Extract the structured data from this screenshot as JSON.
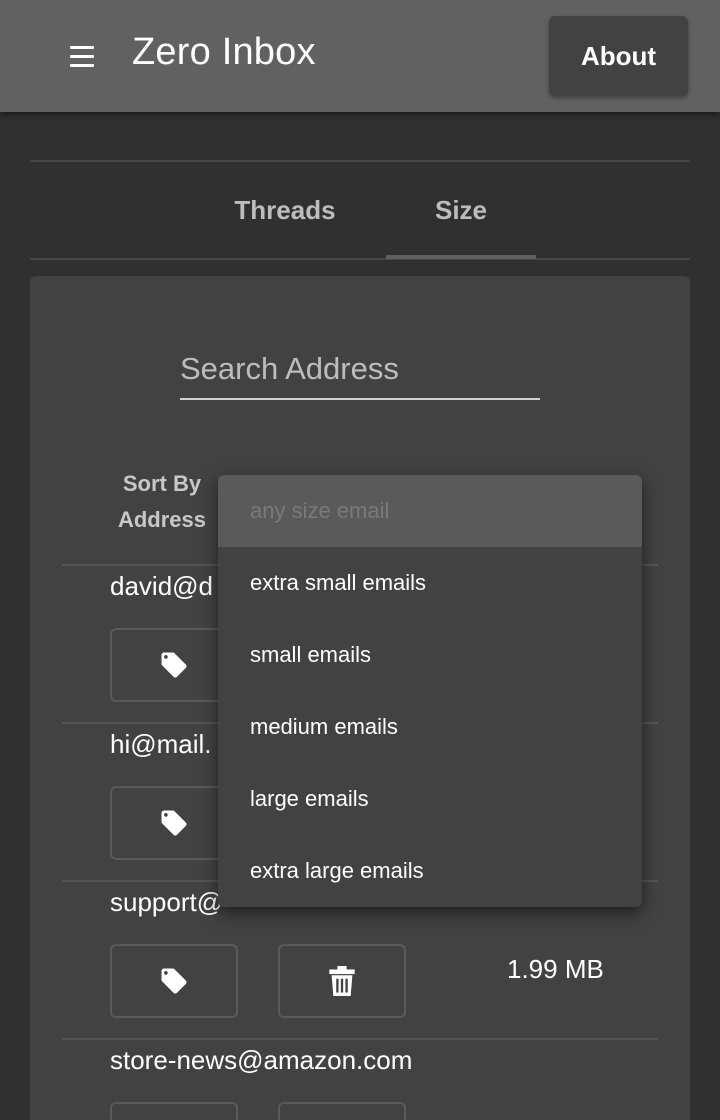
{
  "header": {
    "title": "Zero Inbox",
    "about_label": "About"
  },
  "tabs": [
    {
      "label": "Threads"
    },
    {
      "label": "Size"
    }
  ],
  "search": {
    "placeholder": "Search Address"
  },
  "sort": {
    "label_line1": "Sort By",
    "label_line2": "Address"
  },
  "rows": [
    {
      "address": "david@d",
      "size": ""
    },
    {
      "address": "hi@mail.",
      "size": ""
    },
    {
      "address": "support@",
      "size": "1.99 MB"
    },
    {
      "address": "store-news@amazon.com",
      "size": ""
    }
  ],
  "dropdown": {
    "options": [
      {
        "label": "any size email"
      },
      {
        "label": "extra small emails"
      },
      {
        "label": "small emails"
      },
      {
        "label": "medium emails"
      },
      {
        "label": "large emails"
      },
      {
        "label": "extra large emails"
      }
    ]
  }
}
